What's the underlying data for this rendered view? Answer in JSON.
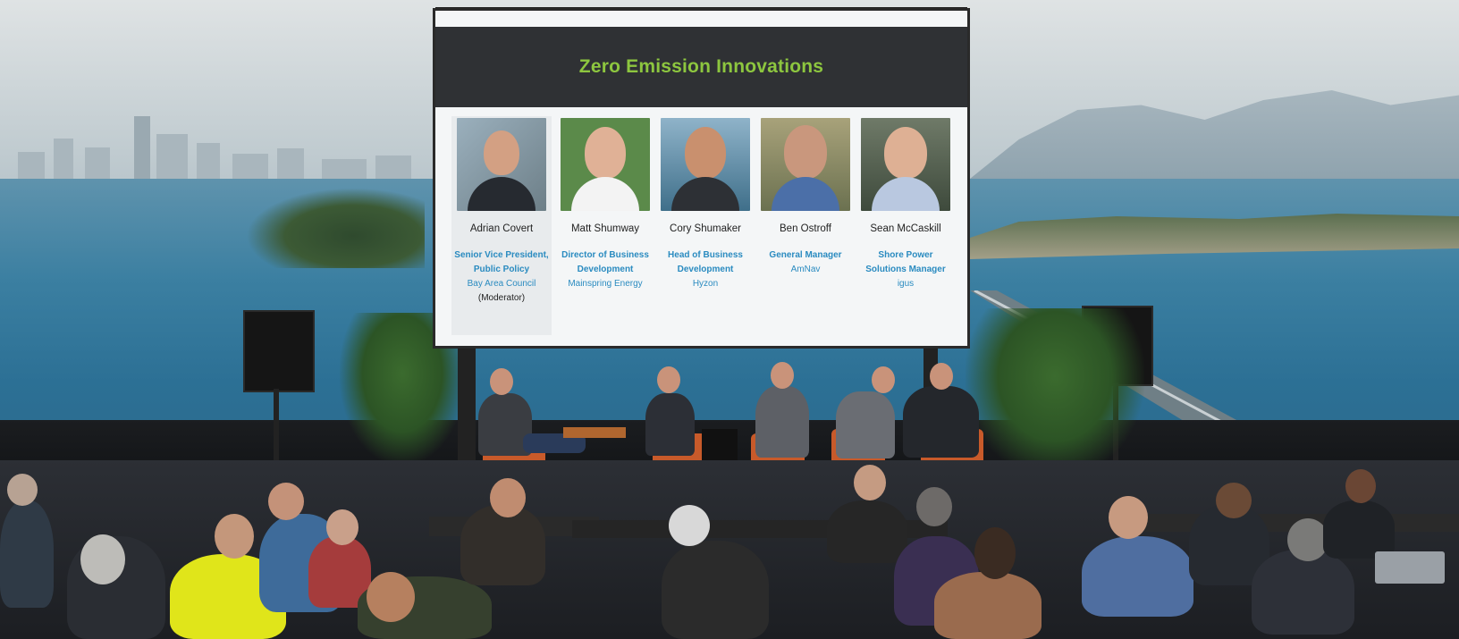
{
  "slide": {
    "title": "Zero Emission Innovations",
    "panelists": [
      {
        "name": "Adrian Covert",
        "role_lines": [
          "Senior Vice President,",
          "Public Policy"
        ],
        "org": "Bay Area Council",
        "note": "(Moderator)"
      },
      {
        "name": "Matt Shumway",
        "role_lines": [
          "Director of Business",
          "Development"
        ],
        "org": "Mainspring Energy",
        "note": ""
      },
      {
        "name": "Cory Shumaker",
        "role_lines": [
          "Head of Business",
          "Development"
        ],
        "org": "Hyzon",
        "note": ""
      },
      {
        "name": "Ben Ostroff",
        "role_lines": [
          "General Manager"
        ],
        "org": "AmNav",
        "note": ""
      },
      {
        "name": "Sean McCaskill",
        "role_lines": [
          "Shore Power",
          "Solutions Manager"
        ],
        "org": "igus",
        "note": ""
      }
    ]
  },
  "colors": {
    "title_green": "#8dc63f",
    "accent_blue": "#2a8bc0",
    "header_dark": "#2f3134",
    "chair_orange": "#c85a2a"
  }
}
